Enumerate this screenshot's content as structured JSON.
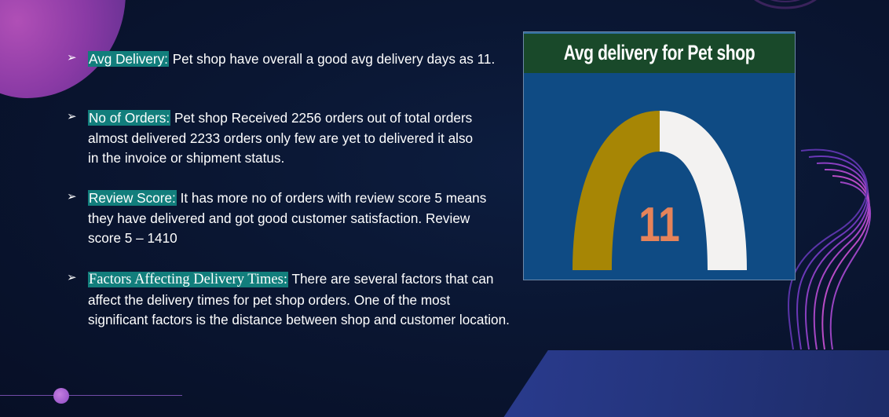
{
  "bullets": [
    {
      "heading": "Avg Delivery:",
      "text": " Pet shop have overall a good avg delivery days as 11."
    },
    {
      "heading": "No of Orders:",
      "text": " Pet shop Received 2256 orders out of total orders almost delivered 2233 orders only few are yet to delivered it also in the invoice or shipment status."
    },
    {
      "heading": "Review Score:",
      "text": " It has more no of orders with review score 5 means they have delivered and got good customer satisfaction. Review score 5 – 1410"
    },
    {
      "heading": "Factors Affecting Delivery Times:",
      "text": " There are several factors that can affect the delivery times for pet shop orders. One of the most significant factors is the distance between shop and customer location."
    }
  ],
  "gauge_card": {
    "title": "Avg delivery for Pet shop",
    "value": "11"
  },
  "colors": {
    "highlight": "#127e7c",
    "gauge_fill": "#a78605",
    "gauge_rest": "#f3f2f1",
    "gauge_value": "#e5835a",
    "card_bg": "#0f4b84",
    "title_bar": "#19492a"
  }
}
